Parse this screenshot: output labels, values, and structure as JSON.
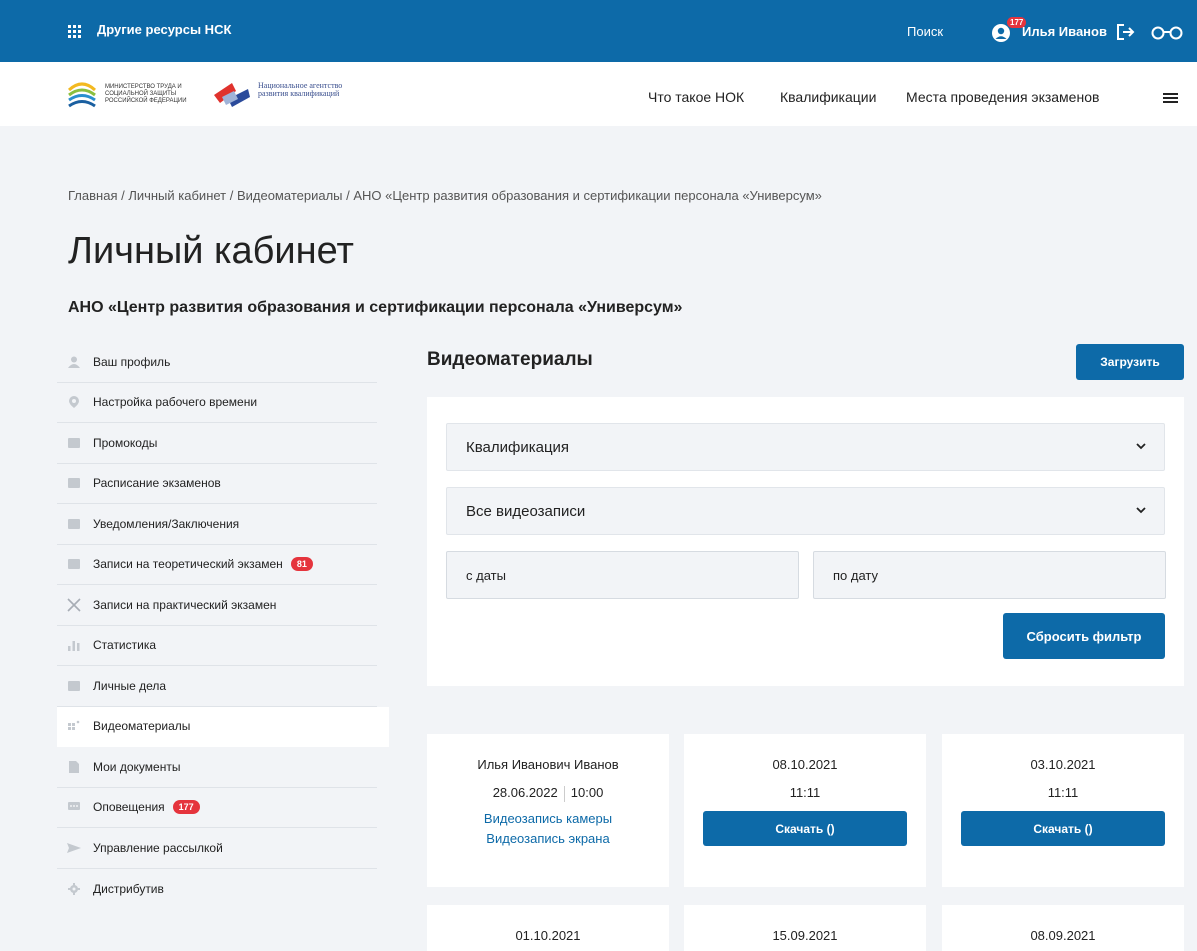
{
  "topbar": {
    "resources_label": "Другие ресурсы НСК",
    "search_label": "Поиск",
    "notifications_count": "177",
    "user_name": "Илья Иванов"
  },
  "header": {
    "logo1_text": "Министерство труда и социальной защиты Российской Федерации",
    "logo2_text": "Национальное агентство развития квалификаций",
    "nav": [
      "Что такое НОК",
      "Квалификации",
      "Места проведения экзаменов"
    ]
  },
  "breadcrumb": "Главная / Личный кабинет / Видеоматериалы / АНО «Центр развития образования и сертификации персонала «Универсум»",
  "page_title": "Личный кабинет",
  "org_title": "АНО «Центр развития образования и сертификации персонала «Универсум»",
  "sidebar": {
    "items": [
      {
        "label": "Ваш профиль",
        "icon": "user-icon"
      },
      {
        "label": "Настройка рабочего времени",
        "icon": "location-pin-icon"
      },
      {
        "label": "Промокоды",
        "icon": "book-icon"
      },
      {
        "label": "Расписание экзаменов",
        "icon": "book-icon"
      },
      {
        "label": "Уведомления/Заключения",
        "icon": "book-icon"
      },
      {
        "label": "Записи на теоретический экзамен",
        "icon": "calendar-icon",
        "badge": "81"
      },
      {
        "label": "Записи на практический экзамен",
        "icon": "tools-icon"
      },
      {
        "label": "Статистика",
        "icon": "bar-chart-icon"
      },
      {
        "label": "Личные дела",
        "icon": "calendar-icon"
      },
      {
        "label": "Видеоматериалы",
        "icon": "video-icon",
        "active": true
      },
      {
        "label": "Мои документы",
        "icon": "document-icon"
      },
      {
        "label": "Оповещения",
        "icon": "chat-icon",
        "badge": "177"
      },
      {
        "label": "Управление рассылкой",
        "icon": "send-icon"
      },
      {
        "label": "Дистрибутив",
        "icon": "gear-icon"
      }
    ]
  },
  "main": {
    "title": "Видеоматериалы",
    "upload_label": "Загрузить",
    "filters": {
      "qualification": "Квалификация",
      "records": "Все видеозаписи",
      "date_from_placeholder": "с даты",
      "date_to_placeholder": "по дату",
      "reset_label": "Сбросить фильтр"
    },
    "cards": [
      {
        "name": "Илья Иванович Иванов",
        "date": "28.06.2022",
        "time": "10:00",
        "link1": "Видеозапись камеры",
        "link2": "Видеозапись экрана"
      },
      {
        "date": "08.10.2021",
        "time": "11:11",
        "button": "Скачать ()"
      },
      {
        "date": "03.10.2021",
        "time": "11:11",
        "button": "Скачать ()"
      },
      {
        "date": "01.10.2021"
      },
      {
        "date": "15.09.2021"
      },
      {
        "date": "08.09.2021"
      }
    ]
  },
  "colors": {
    "primary": "#0d6aa8",
    "badge": "#e5343d",
    "background": "#f2f4f7"
  }
}
